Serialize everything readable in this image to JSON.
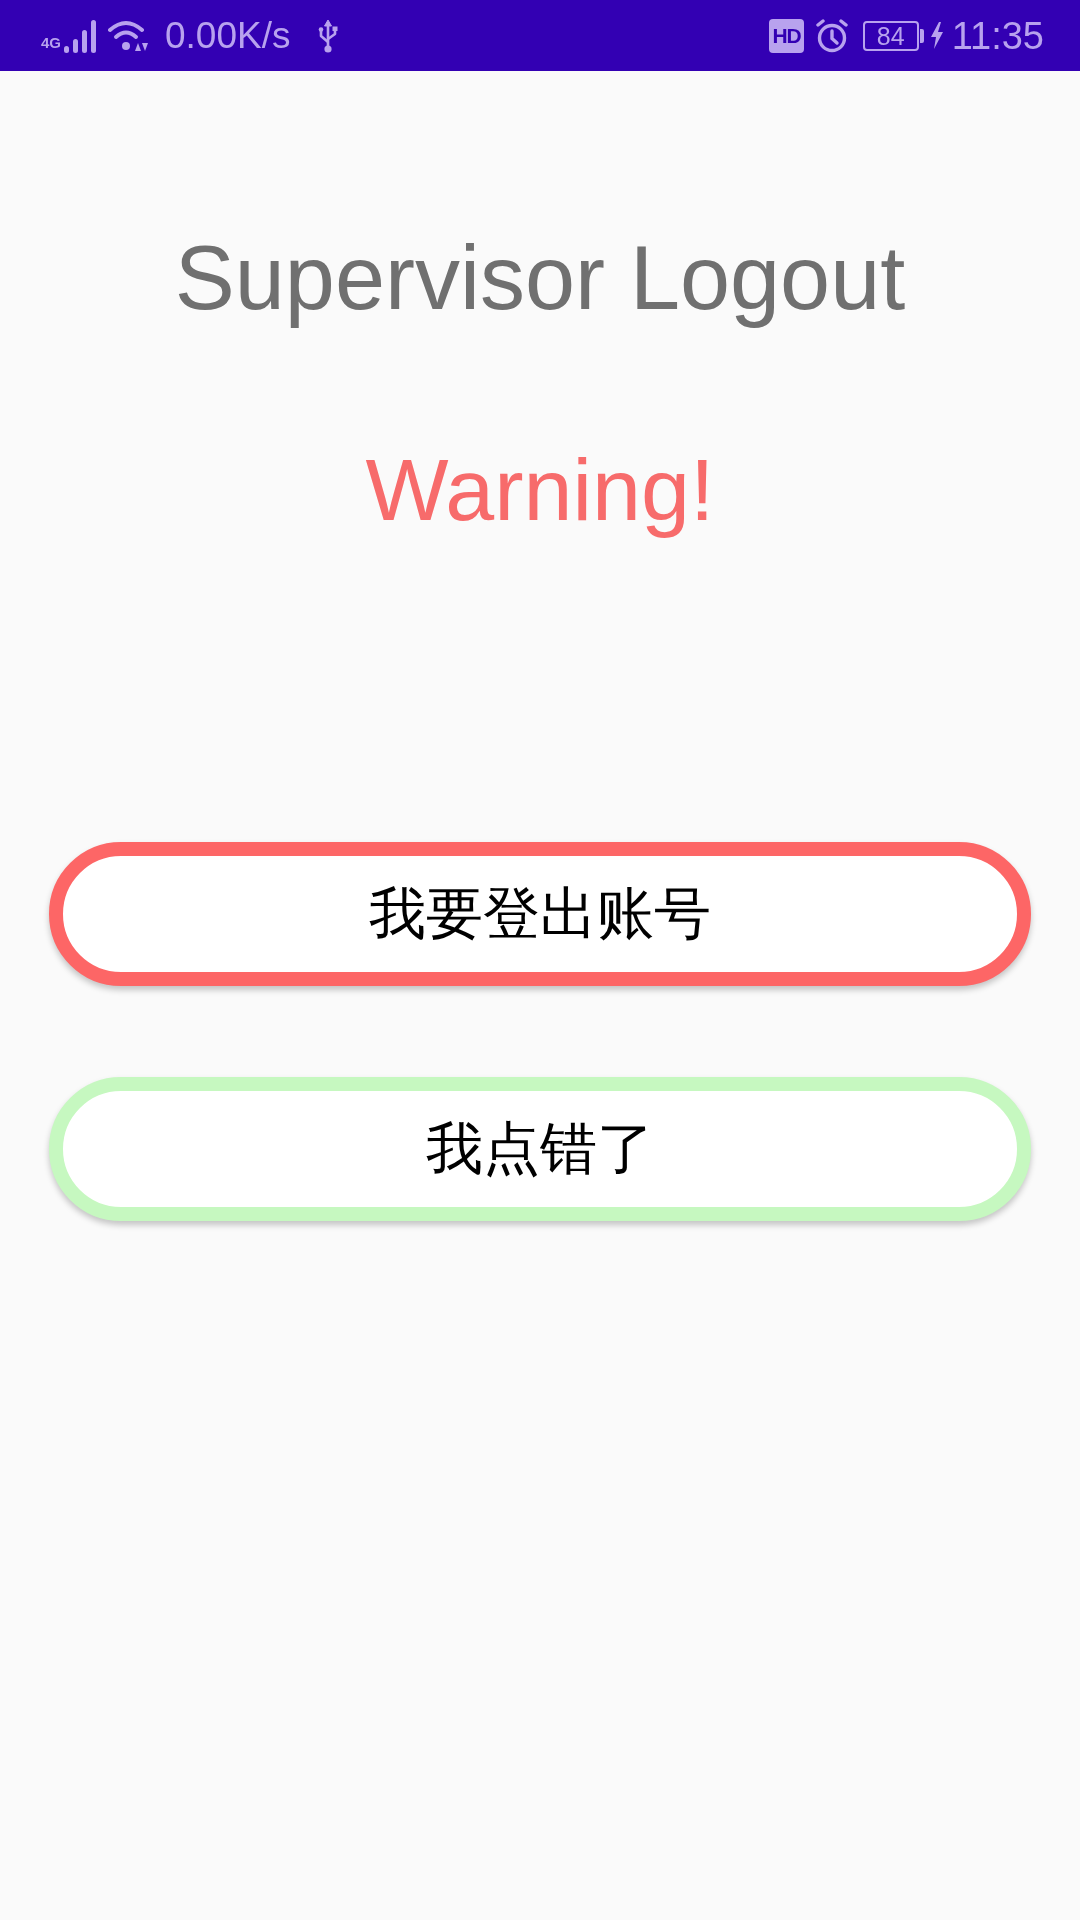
{
  "status_bar": {
    "network": "4G",
    "speed": "0.00K/s",
    "hd": "HD",
    "battery": "84",
    "time": "11:35"
  },
  "title": "Supervisor Logout",
  "warning": "Warning!",
  "buttons": [
    {
      "label": "我要登出账号",
      "color": "#fd6666"
    },
    {
      "label": "我点错了",
      "color": "#c6f8c0"
    }
  ]
}
